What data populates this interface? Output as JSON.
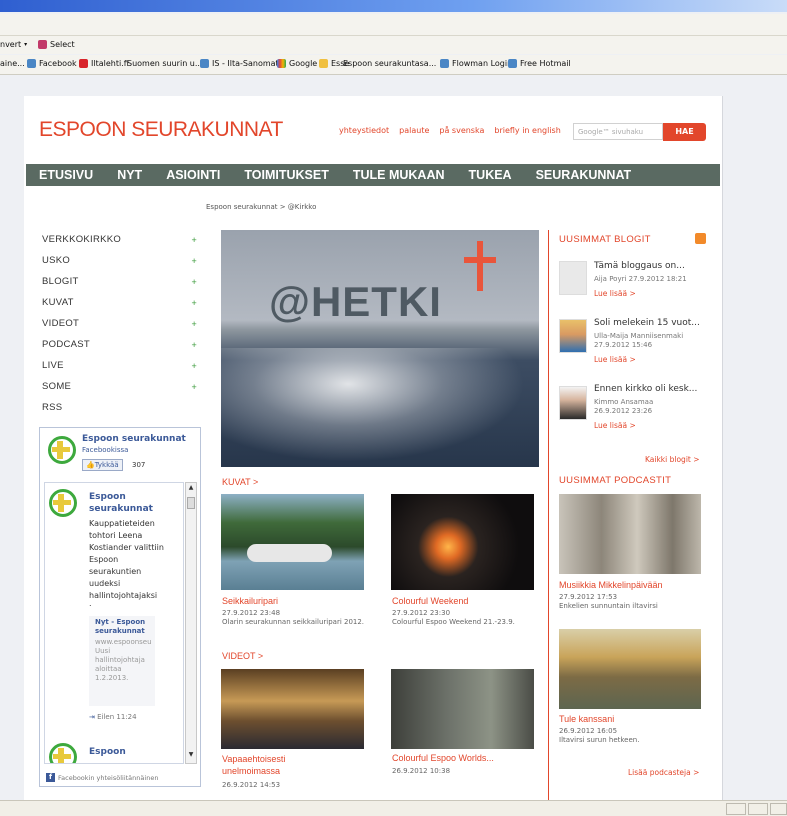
{
  "browser": {
    "menubar": {
      "convert_label": "nvert",
      "select_label": "Select"
    },
    "favorites": [
      "aine...",
      "Facebook",
      "Iltalehti.fi",
      "Suomen suurin u...",
      "IS - Ilta-Sanomat",
      "Google",
      "Esse",
      "Espoon seurakuntasa...",
      "Flowman Login",
      "Free Hotmail"
    ]
  },
  "site": {
    "logo": "ESPOON SEURAKUNNAT",
    "top_links": [
      "yhteystiedot",
      "palaute",
      "på svenska",
      "briefly in english"
    ],
    "search_placeholder": "Google™ sivuhaku",
    "search_button": "HAE",
    "nav": [
      "ETUSIVU",
      "NYT",
      "ASIOINTI",
      "TOIMITUKSET",
      "TULE MUKAAN",
      "TUKEA",
      "SEURAKUNNAT"
    ],
    "breadcrumb": "Espoon seurakunnat > @Kirkko"
  },
  "leftnav": [
    {
      "label": "VERKKOKIRKKO",
      "plus": "+"
    },
    {
      "label": "USKO",
      "plus": "+"
    },
    {
      "label": "BLOGIT",
      "plus": "+"
    },
    {
      "label": "KUVAT",
      "plus": "+"
    },
    {
      "label": "VIDEOT",
      "plus": "+"
    },
    {
      "label": "PODCAST",
      "plus": "+"
    },
    {
      "label": "LIVE",
      "plus": "+"
    },
    {
      "label": "SOME",
      "plus": "+"
    },
    {
      "label": "RSS",
      "plus": ""
    }
  ],
  "facebook": {
    "page_name": "Espoon seurakunnat",
    "sub": "Facebookissa",
    "like_label": "Tykkää",
    "like_count": "307",
    "post_author": "Espoon seurakunnat",
    "post_text": "Kauppatieteiden tohtori Leena Kostiander valittiin Espoon seurakuntien uudeksi hallintojohtajaksi",
    "post_dot": ".",
    "share_title": "Nyt - Espoon seurakunnat",
    "share_url": "www.espoonseu",
    "share_text": "Uusi hallintojohtaja aloittaa 1.2.2013.",
    "post_time": "Eilen 11:24",
    "next_author": "Espoon",
    "footer": "Facebookin yhteisöliitännäinen"
  },
  "hero": {
    "text": "@HETKI"
  },
  "center": {
    "kuvat_heading": "KUVAT >",
    "videot_heading": "VIDEOT >",
    "kuvat": [
      {
        "title": "Seikkailuripari",
        "date": "27.9.2012 23:48",
        "desc": "Olarin seurakunnan seikkailuripari 2012."
      },
      {
        "title": "Colourful Weekend",
        "date": "27.9.2012 23:30",
        "desc": "Colourful Espoo Weekend 21.-23.9."
      }
    ],
    "videot": [
      {
        "title": "Vapaaehtoisesti unelmoimassa",
        "date": "26.9.2012 14:53"
      },
      {
        "title": "Colourful Espoo Worlds...",
        "date": "26.9.2012 10:38"
      }
    ]
  },
  "right": {
    "blogs_heading": "UUSIMMAT BLOGIT",
    "blogs": [
      {
        "title": "Tämä bloggaus on...",
        "author": "Aija Poyri",
        "date": "27.9.2012 18:21",
        "more": "Lue lisää >"
      },
      {
        "title": "Soli melekein 15 vuot...",
        "author": "Ulla-Maija Manniisenmaki",
        "date": "27.9.2012 15:46",
        "more": "Lue lisää >"
      },
      {
        "title": "Ennen kirkko oli kesk...",
        "author": "Kimmo Ansamaa",
        "date": "26.9.2012 23:26",
        "more": "Lue lisää >"
      }
    ],
    "all_blogs": "Kaikki blogit >",
    "podcast_heading": "UUSIMMAT PODCASTIT",
    "podcasts": [
      {
        "title": "Musiikkia Mikkelinpäivään",
        "date": "27.9.2012 17:53",
        "desc": "Enkelien sunnuntain iltavirsi"
      },
      {
        "title": "Tule kanssani",
        "date": "26.9.2012 16:05",
        "desc": "Iltavirsi surun hetkeen."
      }
    ],
    "more_podcasts": "Lisää podcasteja >"
  },
  "colors": {
    "accent": "#e2462b",
    "nav": "#5a6a62",
    "fb_blue": "#3b5998"
  }
}
